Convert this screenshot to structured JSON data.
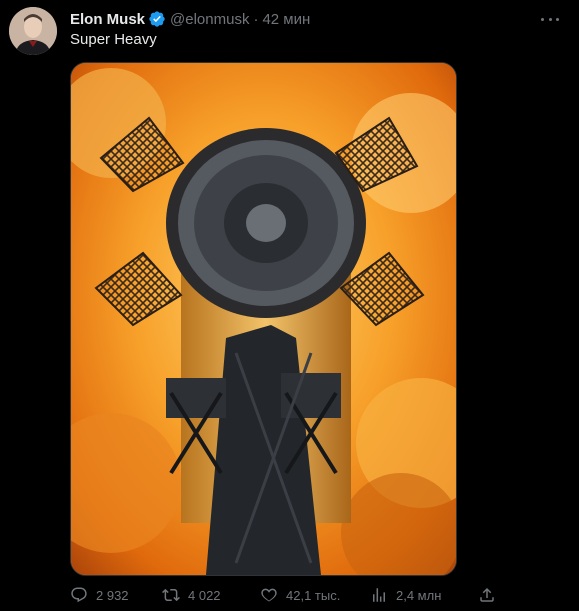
{
  "tweet": {
    "author_name": "Elon Musk",
    "author_handle": "@elonmusk",
    "separator": "·",
    "time": "42 мин",
    "text": "Super Heavy",
    "media_icon": "rocket-photo",
    "colors": {
      "verified": "#1d9bf0",
      "muted": "#71767b",
      "text": "#e7e9ea",
      "background": "#000000"
    }
  },
  "actions": {
    "reply_count": "2 932",
    "retweet_count": "4 022",
    "like_count": "42,1 тыс.",
    "views_count": "2,4 млн",
    "icons": [
      "reply-icon",
      "retweet-icon",
      "like-icon",
      "views-icon",
      "share-icon"
    ]
  }
}
